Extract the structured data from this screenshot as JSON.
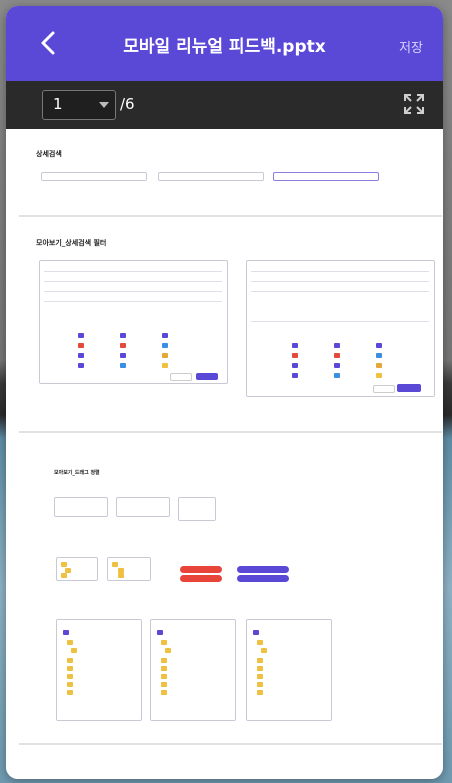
{
  "header": {
    "title": "모바일 리뉴얼 피드백.pptx",
    "save_label": "저장"
  },
  "toolbar": {
    "current_page": "1",
    "total_pages": "/6"
  },
  "slides": [
    {
      "heading": "상세검색"
    },
    {
      "heading": "모아보기_상세검색 필터"
    },
    {
      "heading": "모아보기_드래그 정렬",
      "sections": [
        "",
        "",
        "",
        "",
        ""
      ]
    }
  ],
  "colors": {
    "header": "#5a48d6",
    "toolbar": "#2a2a2a",
    "accent": "#5a48d6"
  }
}
